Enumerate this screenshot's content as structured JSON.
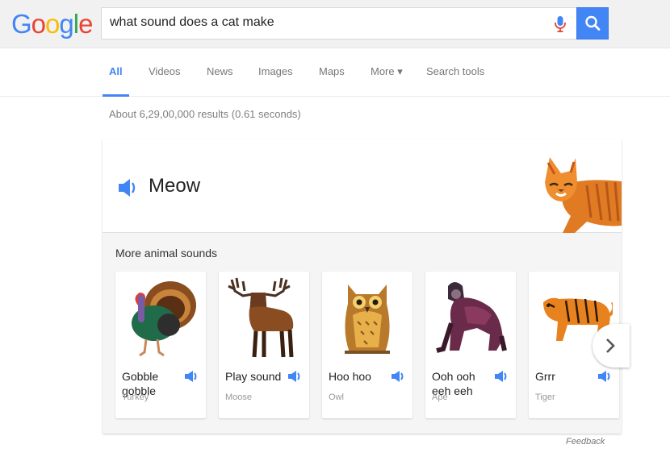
{
  "header": {
    "logo": {
      "letters": [
        "G",
        "o",
        "o",
        "g",
        "l",
        "e"
      ],
      "colors": [
        "#4285f4",
        "#ea4335",
        "#fbbc05",
        "#4285f4",
        "#34a853",
        "#ea4335"
      ]
    },
    "search": {
      "value": "what sound does a cat make"
    }
  },
  "tabs": [
    {
      "label": "All",
      "active": true
    },
    {
      "label": "Videos"
    },
    {
      "label": "News"
    },
    {
      "label": "Images"
    },
    {
      "label": "Maps"
    },
    {
      "label": "More ▾"
    },
    {
      "label": "Search tools"
    }
  ],
  "stats": "About 6,29,00,000 results (0.61 seconds)",
  "result": {
    "sound": "Meow",
    "more_label": "More animal sounds",
    "animals": [
      {
        "name": "Gobble gobble",
        "species": "Turkey"
      },
      {
        "name": "Play sound",
        "species": "Moose"
      },
      {
        "name": "Hoo hoo",
        "species": "Owl"
      },
      {
        "name": "Ooh ooh eeh eeh",
        "species": "Ape"
      },
      {
        "name": "Grrr",
        "species": "Tiger"
      }
    ]
  },
  "feedback": "Feedback",
  "colors": {
    "accent": "#4285f4"
  }
}
